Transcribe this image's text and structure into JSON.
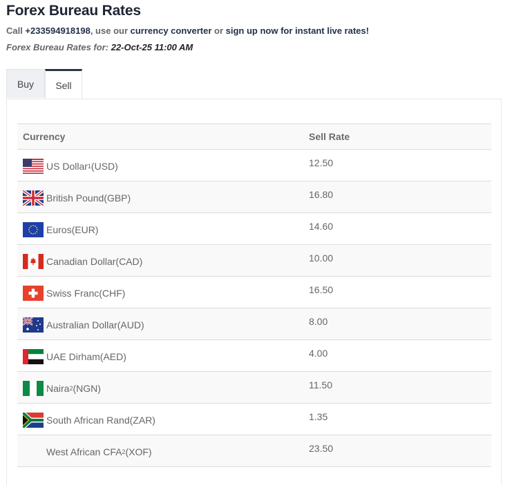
{
  "header": {
    "title": "Forex Bureau Rates",
    "call_prefix": "Call ",
    "phone": "+233594918198",
    "use_our": ", use our ",
    "converter_link": "currency converter",
    "or": " or ",
    "signup_link": "sign up now for instant live rates!",
    "date_label": "Forex Bureau Rates for:",
    "date_value": "22-Oct-25 11:00 AM"
  },
  "tabs": [
    {
      "label": "Buy",
      "active": false
    },
    {
      "label": "Sell",
      "active": true
    }
  ],
  "table": {
    "columns": [
      "Currency",
      "Sell Rate"
    ],
    "rows": [
      {
        "name": "US Dollar",
        "sup": "1",
        "code": " (USD)",
        "rate": "12.50",
        "flag": "flag-us-icon"
      },
      {
        "name": "British Pound",
        "sup": "",
        "code": " (GBP)",
        "rate": "16.80",
        "flag": "flag-gb-icon"
      },
      {
        "name": "Euros",
        "sup": "",
        "code": " (EUR)",
        "rate": "14.60",
        "flag": "flag-eu-icon"
      },
      {
        "name": "Canadian Dollar",
        "sup": "",
        "code": " (CAD)",
        "rate": "10.00",
        "flag": "flag-ca-icon"
      },
      {
        "name": "Swiss Franc",
        "sup": "",
        "code": " (CHF)",
        "rate": "16.50",
        "flag": "flag-ch-icon"
      },
      {
        "name": "Australian Dollar",
        "sup": "",
        "code": " (AUD)",
        "rate": "8.00",
        "flag": "flag-au-icon"
      },
      {
        "name": "UAE Dirham",
        "sup": "",
        "code": " (AED)",
        "rate": "4.00",
        "flag": "flag-ae-icon"
      },
      {
        "name": "Naira",
        "sup": "2",
        "code": " (NGN)",
        "rate": "11.50",
        "flag": "flag-ng-icon"
      },
      {
        "name": "South African Rand",
        "sup": "",
        "code": " (ZAR)",
        "rate": "1.35",
        "flag": "flag-za-icon"
      },
      {
        "name": "West African CFA",
        "sup": "2",
        "code": " (XOF)",
        "rate": "23.50",
        "flag": "flag-xof-icon"
      }
    ]
  },
  "colors": {
    "accent": "#2a344a",
    "row_alt": "#f9f9f9",
    "border": "#dcdcdc"
  }
}
